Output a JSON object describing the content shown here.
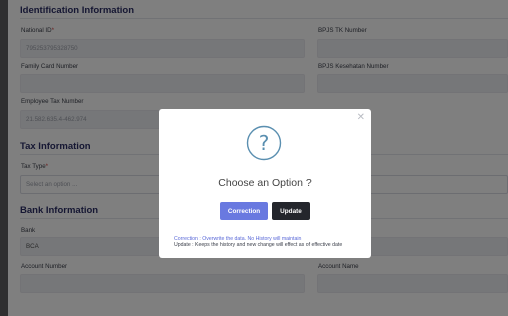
{
  "identification": {
    "title": "Identification Information",
    "national_id_label": "National ID",
    "national_id_required": "*",
    "national_id_value": "795253795328750",
    "bpjs_tk_label": "BPJS TK Number",
    "family_card_label": "Family Card Number",
    "bpjs_kesehatan_label": "BPJS Kesehatan Number",
    "employee_tax_label": "Employee Tax Number",
    "employee_tax_value": "21.582.635.4-462.974"
  },
  "tax": {
    "title": "Tax Information",
    "tax_type_label": "Tax Type",
    "tax_type_required": "*",
    "tax_type_placeholder": "Select an option ..."
  },
  "bank": {
    "title": "Bank Information",
    "bank_label": "Bank",
    "bank_value": "BCA",
    "account_number_label": "Account Number",
    "account_name_label": "Account Name"
  },
  "modal": {
    "close_symbol": "✕",
    "icon": "question-circle-icon",
    "title": "Choose an Option ?",
    "correction_label": "Correction",
    "update_label": "Update",
    "correction_note": "Correction : Overwrite the data. No History will maintain",
    "update_note": "Update : Keeps the history and new change will effect as of effective date"
  },
  "colors": {
    "section_title": "#2c2f66",
    "correction_button": "#6979e0",
    "update_button": "#24262c",
    "icon_stroke": "#5a8fb0"
  }
}
